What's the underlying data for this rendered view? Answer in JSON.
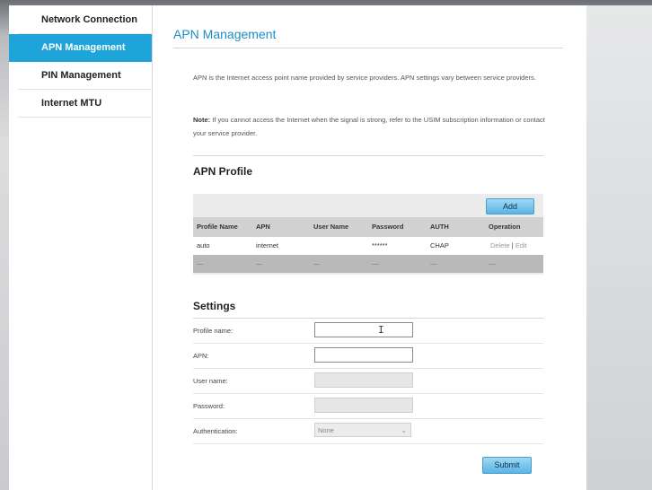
{
  "sidebar": {
    "items": [
      {
        "label": "Network Connection",
        "active": false
      },
      {
        "label": "APN Management",
        "active": true
      },
      {
        "label": "PIN Management",
        "active": false
      },
      {
        "label": "Internet MTU",
        "active": false
      }
    ]
  },
  "main": {
    "title": "APN Management",
    "intro": "APN is the Internet access point name provided by service providers. APN settings vary between service providers.",
    "note_label": "Note:",
    "note_text": " If you cannot access the Internet when the signal is strong, refer to the USIM subscription information or contact your service provider."
  },
  "profile": {
    "title": "APN Profile",
    "add_label": "Add",
    "columns": [
      "Profile Name",
      "APN",
      "User Name",
      "Password",
      "AUTH",
      "Operation"
    ],
    "rows": [
      {
        "profile_name": "auto",
        "apn": "internet",
        "user_name": "",
        "password": "******",
        "auth": "CHAP",
        "delete": "Delete",
        "separator": "|",
        "edit": "Edit"
      }
    ],
    "empty_row": [
      "—",
      "—",
      "—",
      "—",
      "—",
      "—"
    ]
  },
  "settings": {
    "title": "Settings",
    "fields": {
      "profile_name": {
        "label": "Profile name:",
        "value": ""
      },
      "apn": {
        "label": "APN:",
        "value": ""
      },
      "user_name": {
        "label": "User name:",
        "value": ""
      },
      "password": {
        "label": "Password:",
        "value": ""
      },
      "authentication": {
        "label": "Authentication:",
        "value": "None"
      }
    },
    "submit_label": "Submit"
  },
  "colors": {
    "accent": "#1ea4d8",
    "title_blue": "#1e8bc6",
    "button": "#5ab5e6"
  }
}
